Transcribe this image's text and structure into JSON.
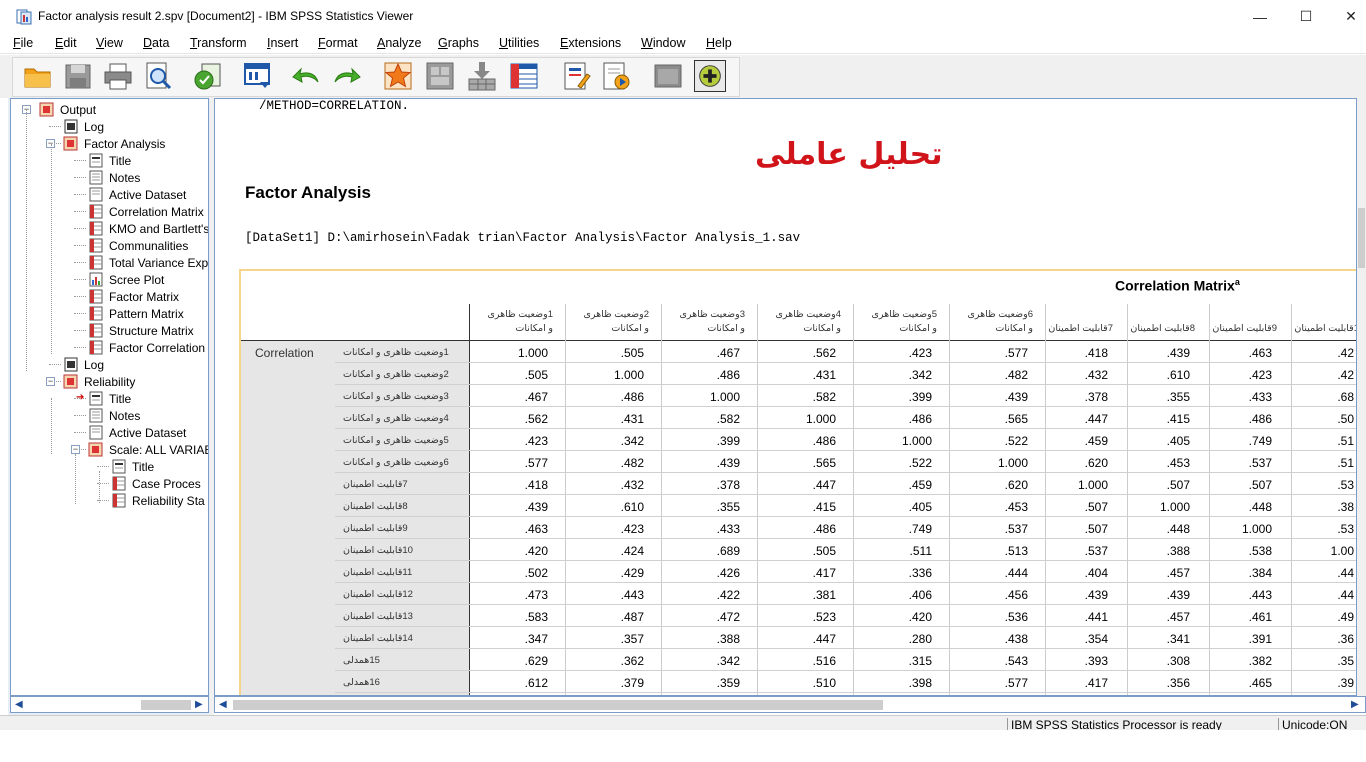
{
  "window": {
    "title": "Factor analysis result 2.spv [Document2] - IBM SPSS Statistics Viewer",
    "minimize": "—",
    "maximize": "☐",
    "close": "✕"
  },
  "menu": [
    "File",
    "Edit",
    "View",
    "Data",
    "Transform",
    "Insert",
    "Format",
    "Analyze",
    "Graphs",
    "Utilities",
    "Extensions",
    "Window",
    "Help"
  ],
  "toolbar": {
    "icons": [
      "open-icon",
      "save-icon",
      "print-icon",
      "print-preview-icon",
      "export-icon",
      "recall-dialog-icon",
      "undo-icon",
      "redo-icon",
      "goto-case-icon",
      "goto-variable-icon",
      "insert-cases-icon",
      "variables-icon",
      "create-title-icon",
      "create-script-icon",
      "designate-window-icon",
      "add-output-icon"
    ]
  },
  "outline": {
    "nodes": [
      {
        "label": "Output",
        "icon": "output-book-icon"
      },
      {
        "label": "Log",
        "icon": "log-icon"
      },
      {
        "label": "Factor Analysis",
        "icon": "procedure-book-icon"
      },
      {
        "label": "Title",
        "icon": "title-icon"
      },
      {
        "label": "Notes",
        "icon": "notes-icon"
      },
      {
        "label": "Active Dataset",
        "icon": "text-icon"
      },
      {
        "label": "Correlation Matrix",
        "icon": "table-icon"
      },
      {
        "label": "KMO and Bartlett's",
        "icon": "table-icon"
      },
      {
        "label": "Communalities",
        "icon": "table-icon"
      },
      {
        "label": "Total Variance Exp",
        "icon": "table-icon"
      },
      {
        "label": "Scree Plot",
        "icon": "chart-icon"
      },
      {
        "label": "Factor Matrix",
        "icon": "table-icon"
      },
      {
        "label": "Pattern Matrix",
        "icon": "table-icon"
      },
      {
        "label": "Structure Matrix",
        "icon": "table-icon"
      },
      {
        "label": "Factor Correlation",
        "icon": "table-icon"
      },
      {
        "label": "Log",
        "icon": "log-icon"
      },
      {
        "label": "Reliability",
        "icon": "procedure-book-icon"
      },
      {
        "label": "Title",
        "icon": "title-icon"
      },
      {
        "label": "Notes",
        "icon": "notes-icon"
      },
      {
        "label": "Active Dataset",
        "icon": "text-icon"
      },
      {
        "label": "Scale: ALL VARIAE",
        "icon": "procedure-book-icon"
      },
      {
        "label": "Title",
        "icon": "title-icon"
      },
      {
        "label": "Case Proces",
        "icon": "table-icon"
      },
      {
        "label": "Reliability Sta",
        "icon": "table-icon"
      }
    ]
  },
  "content": {
    "syntax_line": "/METHOD=CORRELATION.",
    "persian_title": "تحلیل عاملی",
    "heading": "Factor Analysis",
    "dataset_line": "[DataSet1] D:\\amirhosein\\Fadak trian\\Factor Analysis\\Factor Analysis_1.sav",
    "table_title": "Correlation Matrix",
    "table_title_sup": "a",
    "correlation_label": "Correlation",
    "columns": [
      {
        "line1": "1وضعیت ظاهری",
        "line2": "و امکانات"
      },
      {
        "line1": "2وضعیت ظاهری",
        "line2": "و امکانات"
      },
      {
        "line1": "3وضعیت ظاهری",
        "line2": "و امکانات"
      },
      {
        "line1": "4وضعیت ظاهری",
        "line2": "و امکانات"
      },
      {
        "line1": "5وضعیت ظاهری",
        "line2": "و امکانات"
      },
      {
        "line1": "6وضعیت ظاهری",
        "line2": "و امکانات"
      },
      {
        "line1": "",
        "line2": "7قابلیت اطمینان"
      },
      {
        "line1": "",
        "line2": "8قابلیت اطمینان"
      },
      {
        "line1": "",
        "line2": "9قابلیت اطمینان"
      },
      {
        "line1": "",
        "line2": "1قابلیت اطمینان"
      }
    ],
    "rows": [
      {
        "label": "1وضعیت ظاهری و امکانات",
        "values": [
          "1.000",
          ".505",
          ".467",
          ".562",
          ".423",
          ".577",
          ".418",
          ".439",
          ".463",
          ".42"
        ]
      },
      {
        "label": "2وضعیت ظاهری و امکانات",
        "values": [
          ".505",
          "1.000",
          ".486",
          ".431",
          ".342",
          ".482",
          ".432",
          ".610",
          ".423",
          ".42"
        ]
      },
      {
        "label": "3وضعیت ظاهری و امکانات",
        "values": [
          ".467",
          ".486",
          "1.000",
          ".582",
          ".399",
          ".439",
          ".378",
          ".355",
          ".433",
          ".68"
        ]
      },
      {
        "label": "4وضعیت ظاهری و امکانات",
        "values": [
          ".562",
          ".431",
          ".582",
          "1.000",
          ".486",
          ".565",
          ".447",
          ".415",
          ".486",
          ".50"
        ]
      },
      {
        "label": "5وضعیت ظاهری و امکانات",
        "values": [
          ".423",
          ".342",
          ".399",
          ".486",
          "1.000",
          ".522",
          ".459",
          ".405",
          ".749",
          ".51"
        ]
      },
      {
        "label": "6وضعیت ظاهری و امکانات",
        "values": [
          ".577",
          ".482",
          ".439",
          ".565",
          ".522",
          "1.000",
          ".620",
          ".453",
          ".537",
          ".51"
        ]
      },
      {
        "label": "7قابلیت اطمینان",
        "values": [
          ".418",
          ".432",
          ".378",
          ".447",
          ".459",
          ".620",
          "1.000",
          ".507",
          ".507",
          ".53"
        ]
      },
      {
        "label": "8قابلیت اطمینان",
        "values": [
          ".439",
          ".610",
          ".355",
          ".415",
          ".405",
          ".453",
          ".507",
          "1.000",
          ".448",
          ".38"
        ]
      },
      {
        "label": "9قابلیت اطمینان",
        "values": [
          ".463",
          ".423",
          ".433",
          ".486",
          ".749",
          ".537",
          ".507",
          ".448",
          "1.000",
          ".53"
        ]
      },
      {
        "label": "10قابلیت اطمینان",
        "values": [
          ".420",
          ".424",
          ".689",
          ".505",
          ".511",
          ".513",
          ".537",
          ".388",
          ".538",
          "1.00"
        ]
      },
      {
        "label": "11قابلیت اطمینان",
        "values": [
          ".502",
          ".429",
          ".426",
          ".417",
          ".336",
          ".444",
          ".404",
          ".457",
          ".384",
          ".44"
        ]
      },
      {
        "label": "12قابلیت اطمینان",
        "values": [
          ".473",
          ".443",
          ".422",
          ".381",
          ".406",
          ".456",
          ".439",
          ".439",
          ".443",
          ".44"
        ]
      },
      {
        "label": "13قابلیت اطمینان",
        "values": [
          ".583",
          ".487",
          ".472",
          ".523",
          ".420",
          ".536",
          ".441",
          ".457",
          ".461",
          ".49"
        ]
      },
      {
        "label": "14قابلیت اطمینان",
        "values": [
          ".347",
          ".357",
          ".388",
          ".447",
          ".280",
          ".438",
          ".354",
          ".341",
          ".391",
          ".36"
        ]
      },
      {
        "label": "15همدلی",
        "values": [
          ".629",
          ".362",
          ".342",
          ".516",
          ".315",
          ".543",
          ".393",
          ".308",
          ".382",
          ".35"
        ]
      },
      {
        "label": "16همدلی",
        "values": [
          ".612",
          ".379",
          ".359",
          ".510",
          ".398",
          ".577",
          ".417",
          ".356",
          ".465",
          ".39"
        ]
      }
    ]
  },
  "status": {
    "processor": "IBM SPSS Statistics Processor is ready",
    "unicode": "Unicode:ON"
  },
  "colors": {
    "red_title": "#d0141a",
    "row_label_bg": "#e6e6e6",
    "frame_border": "#7a9cc6",
    "selected_border": "#f5d58a"
  }
}
